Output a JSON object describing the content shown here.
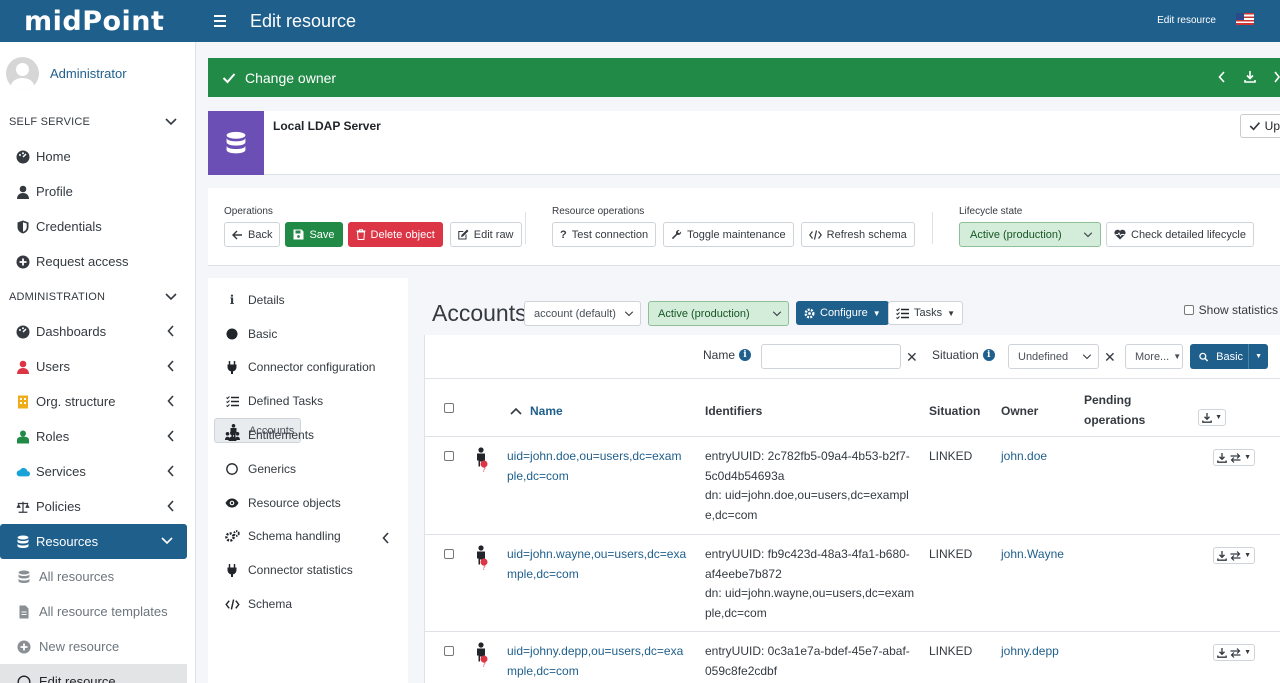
{
  "app": {
    "logo": "midPoint",
    "page_title": "Edit resource",
    "top_right_label": "Edit resource",
    "language_flag": "us-flag-icon"
  },
  "sidebar": {
    "user": "Administrator",
    "self_service_header": "SELF SERVICE",
    "self_service": [
      {
        "label": "Home",
        "icon": "dashboard-icon"
      },
      {
        "label": "Profile",
        "icon": "user-icon"
      },
      {
        "label": "Credentials",
        "icon": "shield-icon"
      },
      {
        "label": "Request access",
        "icon": "plus-circle-icon"
      }
    ],
    "administration_header": "ADMINISTRATION",
    "administration": [
      {
        "label": "Dashboards",
        "icon": "dashboard-icon"
      },
      {
        "label": "Users",
        "icon": "user-icon",
        "color": "#dc3545"
      },
      {
        "label": "Org. structure",
        "icon": "building-icon",
        "color": "#f0ad1a"
      },
      {
        "label": "Roles",
        "icon": "roles-icon",
        "color": "#218a46"
      },
      {
        "label": "Services",
        "icon": "cloud-icon",
        "color": "#17a2d8"
      },
      {
        "label": "Policies",
        "icon": "balance-icon"
      },
      {
        "label": "Resources",
        "icon": "database-icon"
      }
    ],
    "resources_sub": [
      {
        "label": "All resources"
      },
      {
        "label": "All resource templates"
      },
      {
        "label": "New resource"
      },
      {
        "label": "Edit resource"
      }
    ]
  },
  "banner": {
    "label": "Change owner",
    "color": "#218a46"
  },
  "resource": {
    "name": "Local LDAP Server",
    "update_button": "Up"
  },
  "operations": {
    "label": "Operations",
    "back": "Back",
    "save": "Save",
    "delete": "Delete object",
    "edit_raw": "Edit raw",
    "resource_ops_label": "Resource operations",
    "test_connection": "Test connection",
    "toggle_maintenance": "Toggle maintenance",
    "refresh_schema": "Refresh schema",
    "lifecycle_label": "Lifecycle state",
    "lifecycle_value": "Active (production)",
    "check_lifecycle": "Check detailed lifecycle"
  },
  "tabs": [
    "Details",
    "Basic",
    "Connector configuration",
    "Defined Tasks",
    "Accounts",
    "Entitlements",
    "Generics",
    "Resource objects",
    "Schema handling",
    "Connector statistics",
    "Schema"
  ],
  "accounts": {
    "title": "Accounts",
    "kind_select": "account (default)",
    "lifecycle_select": "Active (production)",
    "configure": "Configure",
    "tasks": "Tasks",
    "show_statistics": "Show statistics",
    "search": {
      "name_label": "Name",
      "name_value": "",
      "situation_label": "Situation",
      "situation_value": "Undefined",
      "more": "More...",
      "mode": "Basic"
    },
    "columns": {
      "name": "Name",
      "identifiers": "Identifiers",
      "situation": "Situation",
      "owner": "Owner",
      "pending": "Pending operations"
    },
    "rows": [
      {
        "name": "uid=john.doe,ou=users,dc=example,dc=com",
        "uuid": "entryUUID: 2c782fb5-09a4-4b53-b2f7-5c0d4b54693a",
        "dn": "dn: uid=john.doe,ou=users,dc=example,dc=com",
        "situation": "LINKED",
        "owner": "john.doe"
      },
      {
        "name": "uid=john.wayne,ou=users,dc=example,dc=com",
        "uuid": "entryUUID: fb9c423d-48a3-4fa1-b680-af4eebe7b872",
        "dn": "dn: uid=john.wayne,ou=users,dc=example,dc=com",
        "situation": "LINKED",
        "owner": "john.Wayne"
      },
      {
        "name": "uid=johny.depp,ou=users,dc=example,dc=com",
        "uuid": "entryUUID: 0c3a1e7a-bdef-45e7-abaf-059c8fe2cdbf",
        "dn": "",
        "situation": "LINKED",
        "owner": "johny.depp"
      }
    ]
  }
}
